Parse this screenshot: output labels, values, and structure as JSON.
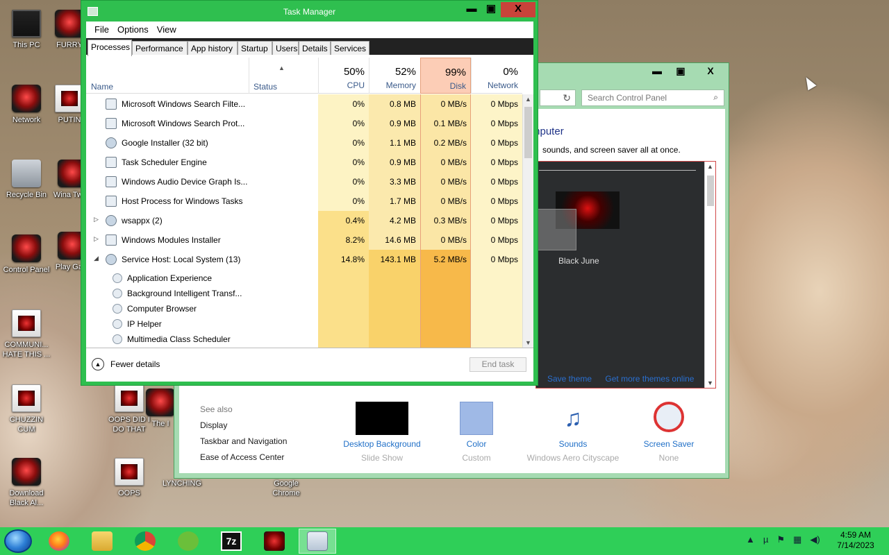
{
  "desktop": {
    "icons": [
      {
        "label": "This PC"
      },
      {
        "label": "FURRY"
      },
      {
        "label": "Network"
      },
      {
        "label": "PUTIN"
      },
      {
        "label": "Recycle Bin"
      },
      {
        "label": "Wina Twea"
      },
      {
        "label": "Control Panel"
      },
      {
        "label": "Play Gam"
      },
      {
        "label": "COMMUNI... HATE THIS ..."
      },
      {
        "label": "CHUZZIN CUM"
      },
      {
        "label": "OOPS DID I DO THAT"
      },
      {
        "label": "The I"
      },
      {
        "label": "Download Black Al..."
      },
      {
        "label": "OOPS"
      },
      {
        "label": "LYNCHING"
      },
      {
        "label": "Google Chrome"
      }
    ]
  },
  "control_panel": {
    "controls": {
      "minimize": "▬",
      "maximize": "▣",
      "close": "X"
    },
    "nav_refresh": "↻",
    "search_placeholder": "Search Control Panel",
    "heading_partial": "mputer",
    "subheading_partial": "sounds, and screen saver all at once.",
    "theme_name": "Black June",
    "links": {
      "save": "Save theme",
      "more": "Get more themes online"
    },
    "see_also": {
      "title": "See also",
      "items": [
        "Display",
        "Taskbar and Navigation",
        "Ease of Access Center"
      ]
    },
    "options": [
      {
        "title": "Desktop Background",
        "value": "Slide Show",
        "color": "#000000"
      },
      {
        "title": "Color",
        "value": "Custom",
        "color": "#9fb9e6"
      },
      {
        "title": "Sounds",
        "value": "Windows Aero Cityscape"
      },
      {
        "title": "Screen Saver",
        "value": "None"
      }
    ]
  },
  "task_manager": {
    "title": "Task Manager",
    "controls": {
      "minimize": "▬",
      "maximize": "▣",
      "close": "X"
    },
    "menu": [
      "File",
      "Options",
      "View"
    ],
    "tabs": [
      "Processes",
      "Performance",
      "App history",
      "Startup",
      "Users",
      "Details",
      "Services"
    ],
    "active_tab": "Processes",
    "columns": {
      "name": "Name",
      "status": "Status",
      "cpu": {
        "pct": "50%",
        "label": "CPU"
      },
      "memory": {
        "pct": "52%",
        "label": "Memory"
      },
      "disk": {
        "pct": "99%",
        "label": "Disk"
      },
      "network": {
        "pct": "0%",
        "label": "Network"
      }
    },
    "rows": [
      {
        "name": "Microsoft Windows Search Filte...",
        "cpu": "0%",
        "mem": "0.8 MB",
        "disk": "0 MB/s",
        "net": "0 Mbps",
        "expand": ""
      },
      {
        "name": "Microsoft Windows Search Prot...",
        "cpu": "0%",
        "mem": "0.9 MB",
        "disk": "0.1 MB/s",
        "net": "0 Mbps",
        "expand": ""
      },
      {
        "name": "Google Installer (32 bit)",
        "cpu": "0%",
        "mem": "1.1 MB",
        "disk": "0.2 MB/s",
        "net": "0 Mbps",
        "expand": ""
      },
      {
        "name": "Task Scheduler Engine",
        "cpu": "0%",
        "mem": "0.9 MB",
        "disk": "0 MB/s",
        "net": "0 Mbps",
        "expand": ""
      },
      {
        "name": "Windows Audio Device Graph Is...",
        "cpu": "0%",
        "mem": "3.3 MB",
        "disk": "0 MB/s",
        "net": "0 Mbps",
        "expand": ""
      },
      {
        "name": "Host Process for Windows Tasks",
        "cpu": "0%",
        "mem": "1.7 MB",
        "disk": "0 MB/s",
        "net": "0 Mbps",
        "expand": ""
      },
      {
        "name": "wsappx (2)",
        "cpu": "0.4%",
        "mem": "4.2 MB",
        "disk": "0.3 MB/s",
        "net": "0 Mbps",
        "expand": "▷"
      },
      {
        "name": "Windows Modules Installer",
        "cpu": "8.2%",
        "mem": "14.6 MB",
        "disk": "0 MB/s",
        "net": "0 Mbps",
        "expand": "▷"
      },
      {
        "name": "Service Host: Local System (13)",
        "cpu": "14.8%",
        "mem": "143.1 MB",
        "disk": "5.2 MB/s",
        "net": "0 Mbps",
        "expand": "◢"
      }
    ],
    "subitems": [
      "Application Experience",
      "Background Intelligent Transf...",
      "Computer Browser",
      "IP Helper",
      "Multimedia Class Scheduler"
    ],
    "footer": {
      "fewer": "Fewer details",
      "end_task": "End task"
    }
  },
  "taskbar": {
    "items": [
      "Firefox",
      "File Explorer",
      "Google Chrome",
      "uTorrent",
      "7-Zip",
      "Black June",
      "Task Manager"
    ],
    "tray_icons": [
      "up-arrow-icon",
      "utorrent-icon",
      "flag-icon",
      "network-icon",
      "speaker-icon"
    ],
    "time": "4:59 AM",
    "date": "7/14/2023"
  }
}
